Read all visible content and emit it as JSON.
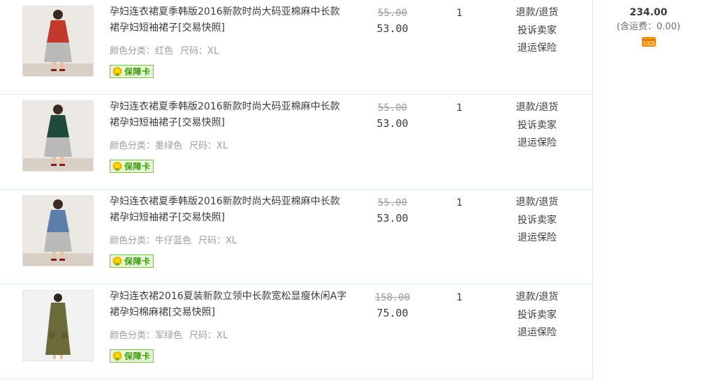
{
  "orders": [
    {
      "title": "孕妇连衣裙夏季韩版2016新款时尚大码亚棉麻中长款裙孕妇短袖裙子[交易快照]",
      "sku_color_label": "颜色分类：",
      "sku_color": "红色",
      "sku_size_label": "尺码：",
      "sku_size": "XL",
      "card_label": "保障卡",
      "original_price": "55.00",
      "price": "53.00",
      "quantity": "1",
      "ops": [
        "退款/退货",
        "投诉卖家",
        "退运保险"
      ],
      "dress_color": "#c0392b"
    },
    {
      "title": "孕妇连衣裙夏季韩版2016新款时尚大码亚棉麻中长款裙孕妇短袖裙子[交易快照]",
      "sku_color_label": "颜色分类：",
      "sku_color": "墨绿色",
      "sku_size_label": "尺码：",
      "sku_size": "XL",
      "card_label": "保障卡",
      "original_price": "55.00",
      "price": "53.00",
      "quantity": "1",
      "ops": [
        "退款/退货",
        "投诉卖家",
        "退运保险"
      ],
      "dress_color": "#1f4a3a"
    },
    {
      "title": "孕妇连衣裙夏季韩版2016新款时尚大码亚棉麻中长款裙孕妇短袖裙子[交易快照]",
      "sku_color_label": "颜色分类：",
      "sku_color": "牛仔蓝色",
      "sku_size_label": "尺码：",
      "sku_size": "XL",
      "card_label": "保障卡",
      "original_price": "55.00",
      "price": "53.00",
      "quantity": "1",
      "ops": [
        "退款/退货",
        "投诉卖家",
        "退运保险"
      ],
      "dress_color": "#5b7fa8"
    },
    {
      "title": "孕妇连衣裙2016夏装新款立领中长款宽松显瘦休闲A字裙孕妇棉麻裙[交易快照]",
      "sku_color_label": "颜色分类：",
      "sku_color": "军绿色",
      "sku_size_label": "尺码：",
      "sku_size": "XL",
      "card_label": "保障卡",
      "original_price": "158.00",
      "price": "75.00",
      "quantity": "1",
      "ops": [
        "退款/退货",
        "投诉卖家",
        "退运保险"
      ],
      "dress_color": "#6b6b3a"
    }
  ],
  "total": {
    "amount": "234.00",
    "shipping": "(含运费：0.00)",
    "pay_icon": "card-payment-icon"
  },
  "colors": {
    "border": "#d8eaf4",
    "card_green": "#3f9b12"
  }
}
